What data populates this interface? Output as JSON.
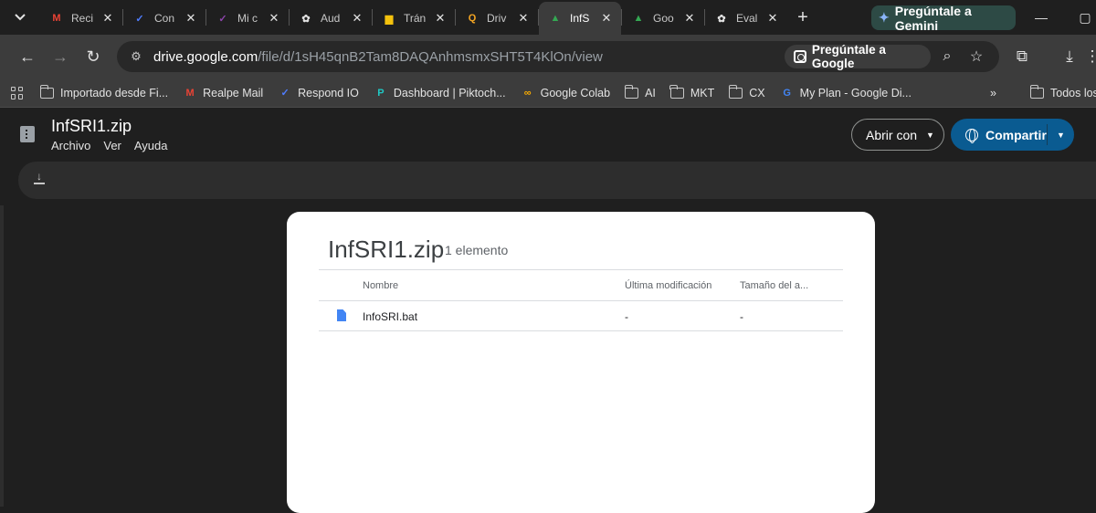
{
  "browser": {
    "tabs": [
      {
        "title": "Reci",
        "icon": "gmail-icon",
        "color": "#ea4335",
        "glyph": "M"
      },
      {
        "title": "Con",
        "icon": "check-icon",
        "color": "#4f7dff",
        "glyph": "✓"
      },
      {
        "title": "Mi c",
        "icon": "check-icon",
        "color": "#8e44ad",
        "glyph": "✓"
      },
      {
        "title": "Aud",
        "icon": "openai-icon",
        "color": "#e3e3e3",
        "glyph": "✿"
      },
      {
        "title": "Trán",
        "icon": "flag-icon",
        "color": "#f4c20d",
        "glyph": "▆"
      },
      {
        "title": "Driv",
        "icon": "search-icon",
        "color": "#f5a623",
        "glyph": "Q"
      },
      {
        "title": "InfS",
        "icon": "google-drive-icon",
        "color": "#34a853",
        "glyph": "▲"
      },
      {
        "title": "Goo",
        "icon": "google-drive-icon",
        "color": "#34a853",
        "glyph": "▲"
      },
      {
        "title": "Eval",
        "icon": "openai-icon",
        "color": "#e3e3e3",
        "glyph": "✿"
      }
    ],
    "active_tab_index": 6,
    "gemini_label": "Pregúntale a Gemini",
    "url_host": "drive.google.com",
    "url_path": "/file/d/1sH45qnB2Tam8DAQAnhmsmxSHT5T4KlOn/view",
    "lens_label": "Pregúntale a Google",
    "bookmarks": [
      {
        "label": "Importado desde Fi...",
        "icon": "folder-icon"
      },
      {
        "label": "Realpe Mail",
        "icon": "gmail-icon",
        "color": "#ea4335",
        "glyph": "M"
      },
      {
        "label": "Respond IO",
        "icon": "check-icon",
        "color": "#4f7dff",
        "glyph": "✓"
      },
      {
        "label": "Dashboard | Piktoch...",
        "icon": "piktochart-icon",
        "color": "#1fc8c4",
        "glyph": "P"
      },
      {
        "label": "Google Colab",
        "icon": "colab-icon",
        "color": "#f9ab00",
        "glyph": "∞"
      },
      {
        "label": "AI",
        "icon": "folder-icon"
      },
      {
        "label": "MKT",
        "icon": "folder-icon"
      },
      {
        "label": "CX",
        "icon": "folder-icon"
      },
      {
        "label": "My Plan - Google Di...",
        "icon": "google-icon",
        "color": "#4285f4",
        "glyph": "G"
      }
    ],
    "bookmarks_overflow": "»",
    "other_bookmarks_label": "Todos los"
  },
  "drive": {
    "file_name": "InfSRI1.zip",
    "menus": [
      "Archivo",
      "Ver",
      "Ayuda"
    ],
    "open_with_label": "Abrir con",
    "share_label": "Compartir"
  },
  "zip": {
    "title": "InfSRI1.zip",
    "count": "1 elemento",
    "columns": {
      "name": "Nombre",
      "modified": "Última modificación",
      "size": "Tamaño del a..."
    },
    "rows": [
      {
        "name": "InfoSRI.bat",
        "modified": "-",
        "size": "-"
      }
    ]
  }
}
